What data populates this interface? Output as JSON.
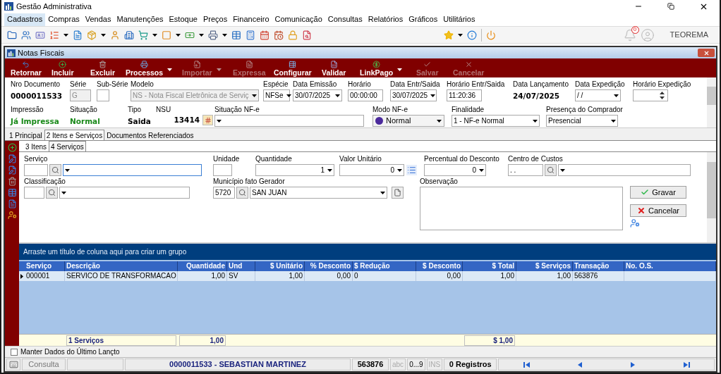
{
  "window": {
    "title": "Gestão Administrativa"
  },
  "menu": [
    {
      "label": "Cadastros",
      "selected": true
    },
    {
      "label": "Compras",
      "selected": false
    },
    {
      "label": "Vendas",
      "selected": false
    },
    {
      "label": "Manutenções",
      "selected": false
    },
    {
      "label": "Estoque",
      "selected": false
    },
    {
      "label": "Preços",
      "selected": false
    },
    {
      "label": "Financeiro",
      "selected": false
    },
    {
      "label": "Comunicação",
      "selected": false
    },
    {
      "label": "Consultas",
      "selected": false
    },
    {
      "label": "Relatórios",
      "selected": false
    },
    {
      "label": "Gráficos",
      "selected": false
    },
    {
      "label": "Utilitários",
      "selected": false
    }
  ],
  "toolbar": {
    "notifications": "0",
    "user": "TEOREMA"
  },
  "form_window": {
    "title": "Notas Fiscais"
  },
  "actions": [
    {
      "label": "Retornar",
      "disabled": false,
      "dropdown": false
    },
    {
      "label": "Incluir",
      "disabled": false,
      "dropdown": false
    },
    {
      "label": "Excluir",
      "disabled": false,
      "dropdown": false
    },
    {
      "label": "Processos",
      "disabled": false,
      "dropdown": true
    },
    {
      "label": "Importar",
      "disabled": true,
      "dropdown": true
    },
    {
      "label": "Expressa",
      "disabled": true,
      "dropdown": false
    },
    {
      "label": "Configurar",
      "disabled": false,
      "dropdown": false
    },
    {
      "label": "Validar",
      "disabled": false,
      "dropdown": false
    },
    {
      "label": "LinkPago",
      "disabled": false,
      "dropdown": true
    },
    {
      "label": "Salvar",
      "disabled": true,
      "dropdown": false
    },
    {
      "label": "Cancelar",
      "disabled": true,
      "dropdown": false
    }
  ],
  "header": {
    "row_1": [
      {
        "label": "Nro Documento",
        "kind": "value",
        "value": "0000011533",
        "color": "#000000"
      },
      {
        "label": "Série",
        "kind": "input",
        "value": "G",
        "disabled": true
      },
      {
        "label": "Sub-Série",
        "kind": "input",
        "disabled": false
      },
      {
        "label": "Modelo",
        "kind": "combo",
        "value": "NS - Nota Fiscal Eletrônica de Serviç",
        "disabled": true
      },
      {
        "label": "Espécie",
        "kind": "combo",
        "value": "NFSe",
        "disabled": false
      },
      {
        "label": "Data Emissão",
        "kind": "combo",
        "value": "30/07/2025",
        "disabled": false
      },
      {
        "label": "Horário",
        "kind": "input",
        "value": "00:00:00",
        "disabled": false
      },
      {
        "label": "Data Entr/Saida",
        "kind": "combo",
        "value": "30/07/2025",
        "disabled": false
      },
      {
        "label": "Horário Entr/Saida",
        "kind": "input",
        "value": "11:20:36",
        "disabled": false
      },
      {
        "label": "Data Lançamento",
        "kind": "value",
        "value": "24/07/2025",
        "color": "#000000"
      },
      {
        "label": "Data Expedição",
        "kind": "combo",
        "value": " / /",
        "disabled": false
      },
      {
        "label": "Horário Expedição",
        "kind": "spin"
      }
    ],
    "row_2": [
      {
        "label": "Impressão",
        "kind": "value",
        "value": "Já Impressa",
        "color": "#1a8a1a"
      },
      {
        "label": "Situação",
        "kind": "value",
        "value": "Normal",
        "color": "#1a8a1a"
      },
      {
        "label": "Tipo",
        "kind": "value",
        "value": "Saida",
        "color": "#000000"
      },
      {
        "label": "NSU",
        "kind": "counter",
        "value": "13414"
      },
      {
        "label": "Situação NF-e",
        "kind": "combo",
        "disabled": false
      },
      {
        "label": "Modo NF-e",
        "kind": "status_combo",
        "value": "Normal",
        "color": "#4b2a9c"
      },
      {
        "label": "Finalidade",
        "kind": "combo",
        "value": "1 - NF-e Normal",
        "disabled": false
      },
      {
        "label": "Presença do Comprador",
        "kind": "combo",
        "value": "Presencial",
        "disabled": false
      }
    ]
  },
  "tabs": [
    {
      "label": "1 Principal",
      "selected": false
    },
    {
      "label": "2 Itens e Serviços",
      "selected": true
    },
    {
      "label": "Documentos Referenciados",
      "selected": false
    }
  ],
  "sub_tabs": [
    {
      "label": "3 Itens",
      "selected": false
    },
    {
      "label": "4 Serviços",
      "selected": true
    }
  ],
  "service_form": {
    "row_a": [
      {
        "label": "Serviço",
        "kind": "lookup",
        "focused": true
      },
      {
        "label": "Unidade",
        "kind": "input"
      },
      {
        "label": "Quantidade",
        "kind": "combo",
        "value": "1"
      },
      {
        "label": "Valor Unitário",
        "kind": "combo_list",
        "value": "0"
      },
      {
        "label": "Percentual do Desconto",
        "kind": "combo",
        "value": "0"
      },
      {
        "label": "Centro de Custos",
        "kind": "lookup",
        "code": ". .",
        "focused": false
      }
    ],
    "row_b": [
      {
        "label": "Classificação",
        "kind": "lookup",
        "focused": false
      },
      {
        "label": "Município fato Gerador",
        "kind": "lookup_file",
        "code": "5720",
        "text": "SAN JUAN",
        "focused": false
      },
      {
        "label": "Observação",
        "kind": "memo"
      }
    ],
    "buttons": [
      {
        "label": "Gravar",
        "kind": "save"
      },
      {
        "label": "Cancelar",
        "kind": "cancel"
      }
    ]
  },
  "grid": {
    "group_hint": "Arraste um título de coluna aqui para criar um grupo",
    "columns": [
      {
        "label": "Serviço"
      },
      {
        "label": "Descrição",
        "summary": "1 Serviços"
      },
      {
        "label": "Quantidade",
        "summary": "1,00"
      },
      {
        "label": "Und"
      },
      {
        "label": "$ Unitário"
      },
      {
        "label": "% Desconto"
      },
      {
        "label": "$ Redução"
      },
      {
        "label": "$ Desconto"
      },
      {
        "label": "$ Total",
        "summary": "$ 1,00"
      },
      {
        "label": "$ Serviços"
      },
      {
        "label": "Transação"
      },
      {
        "label": "No. O.S."
      }
    ],
    "rows": [
      {
        "current": true,
        "cells": [
          "000001",
          "SERVICO DE TRANSFORMACAO",
          "1,00",
          "SV",
          "1,00",
          "0,00",
          "0",
          "0,00",
          "1,00",
          "1,00",
          "563876"
        ]
      }
    ]
  },
  "keep_data": {
    "label": "Manter Dados do Último Lançto",
    "checked": false
  },
  "status_bar": {
    "mode": "Consulta",
    "record": "0000011533 - SEBASTIAN MARTINEZ",
    "transaction": "563876",
    "indicators": [
      {
        "label": "abc",
        "on": false
      },
      {
        "label": "0...9",
        "on": true
      },
      {
        "label": "INS",
        "on": false
      }
    ],
    "count": "0 Registros"
  }
}
